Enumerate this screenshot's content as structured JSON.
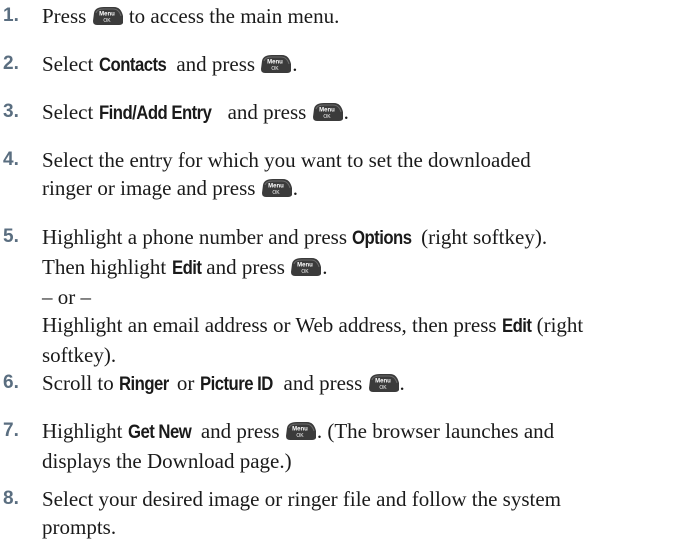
{
  "steps": [
    {
      "num": "1.",
      "t1": "Press ",
      "t2": " to access the main menu."
    },
    {
      "num": "2.",
      "t1": "Select ",
      "k1": "Contacts",
      "t2": " and press ",
      "t3": "."
    },
    {
      "num": "3.",
      "t1": "Select ",
      "k1": "Find/Add Entry",
      "t2": " and press ",
      "t3": "."
    },
    {
      "num": "4.",
      "l1": "Select the entry for which you want to set the downloaded",
      "t1": "ringer or image and press ",
      "t2": "."
    },
    {
      "num": "5.",
      "t1": "Highlight a phone number and press ",
      "k1": "Options",
      "t2": " (right softkey).",
      "t3": "Then highlight ",
      "k2": "Edit",
      "t4": " and press ",
      "t5": ".",
      "or": "– or –",
      "t6": "Highlight an email address or Web address, then press ",
      "k3": "Edit",
      "t7": " (right",
      "t8": "softkey)."
    },
    {
      "num": "6.",
      "t1": "Scroll to ",
      "k1": "Ringer",
      "t2": " or ",
      "k2": "Picture ID",
      "t3": " and press ",
      "t4": "."
    },
    {
      "num": "7.",
      "t1": "Highlight ",
      "k1": "Get New",
      "t2": " and press ",
      "t3": ". (The browser launches and",
      "l2": "displays the Download page.)"
    },
    {
      "num": "8.",
      "l1": "Select your desired image or ringer file and follow the system",
      "l2": "prompts."
    }
  ],
  "icons": {
    "menu_ok": "menu-ok-key-icon",
    "icon_text_top": "Menu",
    "icon_text_bottom": "OK"
  },
  "colors": {
    "step_number": "#5a6e80",
    "text": "#1a1a1a",
    "key_icon": "#3b3b3b"
  }
}
